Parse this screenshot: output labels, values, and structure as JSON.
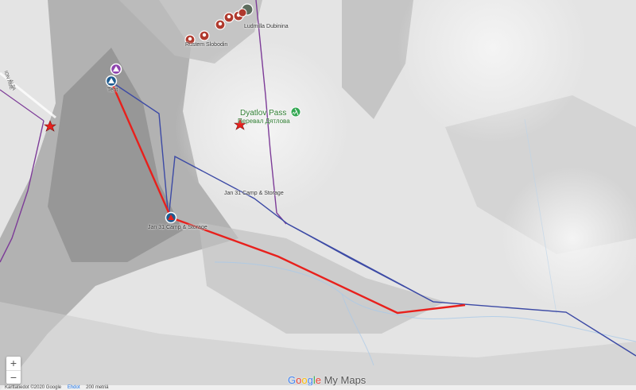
{
  "markers": {
    "tent_label": "Tent",
    "camp_label_1": "Jan 31 Camp & Storage",
    "camp_label_2": "Jan 31 Camp & Storage",
    "dubinina_label": "Ludmilla Dubinina",
    "slobodin_label": "Rustem Slobodin"
  },
  "pass": {
    "name": "Dyatlov Pass",
    "name_local": "Перевал Дятлова"
  },
  "road_text": "ION AUE",
  "road_text_2": "ALTA",
  "zoom": {
    "in": "+",
    "out": "−"
  },
  "brand": {
    "g": "G",
    "o1": "o",
    "o2": "o",
    "g2": "g",
    "l": "l",
    "e": "e",
    "product": "My Maps"
  },
  "footer": {
    "copyright": "Karttatiedot ©2020 Google",
    "terms": "Ehdot",
    "scale": "200 metriä"
  },
  "colors": {
    "route_red": "#e8201c",
    "route_blue": "#3c4aa5",
    "route_purple": "#7d3c98",
    "victim_marker": "#b03a2e",
    "camp_marker": "#1e5b8f",
    "pass_green": "#34a853"
  }
}
